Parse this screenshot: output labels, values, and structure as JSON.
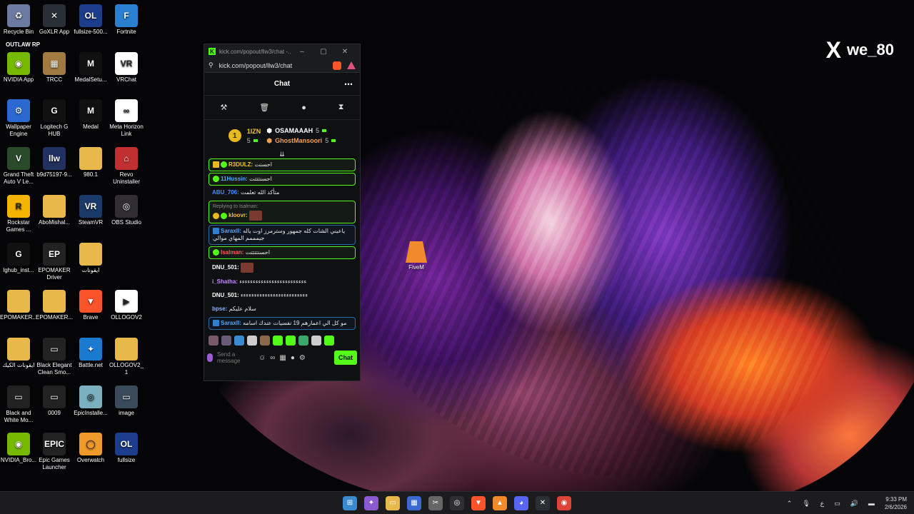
{
  "watermark": {
    "icon": "x-logo-icon",
    "symbol": "X",
    "handle": "we_80"
  },
  "desktop": {
    "icons": [
      {
        "label": "Recycle Bin",
        "name": "recycle-bin-icon",
        "color": "#6a7aa0",
        "glyph": "♻"
      },
      {
        "label": "GoXLR App",
        "name": "goxlr-icon",
        "color": "#2a2f36",
        "glyph": "✕"
      },
      {
        "label": "fullsize-500...",
        "name": "fullsize-icon",
        "color": "#1c3c8c",
        "glyph": "OL"
      },
      {
        "label": "Fortnite",
        "name": "fortnite-icon",
        "color": "#2b7fd0",
        "glyph": "F"
      },
      {
        "label": "NVIDIA App",
        "name": "nvidia-icon",
        "color": "#76b900",
        "glyph": "◉"
      },
      {
        "label": "TRCC",
        "name": "trcc-icon",
        "color": "#a07a40",
        "glyph": "▦"
      },
      {
        "label": "MedalSetu...",
        "name": "medal-setup-icon",
        "color": "#111111",
        "glyph": "M"
      },
      {
        "label": "VRChat",
        "name": "vrchat-icon",
        "color": "#ffffff",
        "glyph": "VR"
      },
      {
        "label": "Wallpaper Engine",
        "name": "wallpaper-engine-icon",
        "color": "#2a6ad0",
        "glyph": "⚙"
      },
      {
        "label": "Logitech G HUB",
        "name": "logitech-icon",
        "color": "#111111",
        "glyph": "G"
      },
      {
        "label": "Medal",
        "name": "medal-icon",
        "color": "#111111",
        "glyph": "M"
      },
      {
        "label": "Meta Horizon Link",
        "name": "meta-icon",
        "color": "#ffffff",
        "glyph": "∞"
      },
      {
        "label": "Grand Theft Auto V Le...",
        "name": "gta-icon",
        "color": "#2a4a2a",
        "glyph": "V"
      },
      {
        "label": "b9d75197-9...",
        "name": "image-file-icon",
        "color": "#203060",
        "glyph": "llw"
      },
      {
        "label": "980.1",
        "name": "folder-icon",
        "color": "#e8b84a",
        "glyph": ""
      },
      {
        "label": "Revo Uninstaller",
        "name": "revo-icon",
        "color": "#c03030",
        "glyph": "⌂"
      },
      {
        "label": "Rockstar Games ...",
        "name": "rockstar-icon",
        "color": "#f4b400",
        "glyph": "R"
      },
      {
        "label": "AboMishal...",
        "name": "folder-icon",
        "color": "#e8b84a",
        "glyph": ""
      },
      {
        "label": "SteamVR",
        "name": "steamvr-icon",
        "color": "#1a3a6a",
        "glyph": "VR"
      },
      {
        "label": "OBS Studio",
        "name": "obs-icon",
        "color": "#302e31",
        "glyph": "◎"
      },
      {
        "label": "lghub_inst...",
        "name": "lghub-icon",
        "color": "#111111",
        "glyph": "G"
      },
      {
        "label": "EPOMAKER Driver",
        "name": "epomaker-icon",
        "color": "#222222",
        "glyph": "EP"
      },
      {
        "label": "ايقونات",
        "name": "folder-icon",
        "color": "#e8b84a",
        "glyph": ""
      },
      {
        "label": "",
        "name": "blank-slot",
        "color": "transparent",
        "glyph": ""
      },
      {
        "label": "EPOMAKER...",
        "name": "folder-icon",
        "color": "#e8b84a",
        "glyph": ""
      },
      {
        "label": "EPOMAKER...",
        "name": "folder-icon",
        "color": "#e8b84a",
        "glyph": ""
      },
      {
        "label": "Brave",
        "name": "brave-icon",
        "color": "#fb542b",
        "glyph": "▼"
      },
      {
        "label": "OLLOGOV2",
        "name": "video-file-icon",
        "color": "#ffffff",
        "glyph": "▶"
      },
      {
        "label": "ايقونات الكيك",
        "name": "folder-icon",
        "color": "#e8b84a",
        "glyph": ""
      },
      {
        "label": "Black Elegant Clean Smo...",
        "name": "video-file-icon",
        "color": "#222222",
        "glyph": "▭"
      },
      {
        "label": "Battle.net",
        "name": "battlenet-icon",
        "color": "#1a7ad0",
        "glyph": "✦"
      },
      {
        "label": "OLLOGOV2_1",
        "name": "folder-icon",
        "color": "#e8b84a",
        "glyph": ""
      },
      {
        "label": "Black and White Mo...",
        "name": "video-file-icon",
        "color": "#222222",
        "glyph": "▭"
      },
      {
        "label": "0009",
        "name": "video-file-icon",
        "color": "#222222",
        "glyph": "▭"
      },
      {
        "label": "EpicInstalle...",
        "name": "installer-icon",
        "color": "#7ab0c0",
        "glyph": "◎"
      },
      {
        "label": "image",
        "name": "image-file-icon",
        "color": "#3a4a5a",
        "glyph": "▭"
      },
      {
        "label": "NVIDIA_Bro...",
        "name": "nvidia-icon",
        "color": "#76b900",
        "glyph": "◉"
      },
      {
        "label": "Epic Games Launcher",
        "name": "epic-icon",
        "color": "#222222",
        "glyph": "EPIC"
      },
      {
        "label": "Overwatch",
        "name": "overwatch-icon",
        "color": "#f09a2a",
        "glyph": "◯"
      },
      {
        "label": "fullsize",
        "name": "fullsize-icon",
        "color": "#1c3c8c",
        "glyph": "OL"
      }
    ],
    "overlay_text": "OUTLAW RP",
    "fivem": {
      "label": "FiveM"
    }
  },
  "chat_window": {
    "title": "kick.com/popout/llw3/chat -...",
    "url": "kick.com/popout/llw3/chat",
    "header": "Chat",
    "mod_tools": [
      "hammer-icon",
      "trash-icon",
      "chat-bubble-icon",
      "hourglass-icon"
    ],
    "leaderboard": {
      "rank": "1",
      "left_user": "1IZN",
      "left_count": "5",
      "right": [
        {
          "user": "OSAMAAAH",
          "count": "5"
        },
        {
          "user": "GhostMansoori",
          "count": "5"
        }
      ]
    },
    "messages": [
      {
        "user": "R3DULZ:",
        "text": "احسنت",
        "color": "#f4c430",
        "style": "hl",
        "badges": [
          "crown",
          "verified"
        ]
      },
      {
        "user": "11Hussin:",
        "text": "احسنتتتت",
        "color": "#53a8ff",
        "style": "hl",
        "badges": [
          "verified"
        ]
      },
      {
        "user": "ABU_706:",
        "text": "متأكد الله تعلمت",
        "color": "#4a8cff",
        "style": "",
        "badges": []
      },
      {
        "reply": "Replying to Isalman:",
        "user": "kloovr:",
        "text": "",
        "color": "#f4c430",
        "style": "hl",
        "badges": [
          "gold",
          "verified"
        ],
        "emote": true
      },
      {
        "user": "Saraxll:",
        "text": "ياعيني الشات كله جمهور وسترمرز اوت ياله جيمممم المهاي موالي",
        "color": "#53a8ff",
        "style": "hl-blue",
        "badges": [
          "blue"
        ]
      },
      {
        "user": "Isalman:",
        "text": "احسنتتتتت",
        "color": "#ff5a5a",
        "style": "hl",
        "badges": [
          "verified"
        ]
      },
      {
        "user": "DNU_501:",
        "text": "",
        "color": "#ffffff",
        "style": "",
        "badges": [],
        "emote": true
      },
      {
        "user": "i_Shatha:",
        "text": "ءءءءءءءءءءءءءءءءءءءءءءءءء",
        "color": "#c78aff",
        "style": "",
        "badges": []
      },
      {
        "user": "DNU_501:",
        "text": "ءءءءءءءءءءءءءءءءءءءءءءءءء",
        "color": "#ffffff",
        "style": "",
        "badges": []
      },
      {
        "user": "bpse:",
        "text": "سلام عليكم",
        "color": "#8ab4ff",
        "style": "",
        "badges": []
      },
      {
        "user": "Saraxll:",
        "text": "مو كل الي اعمارهم 19 نفسيات عندك اسامه",
        "color": "#53a8ff",
        "style": "hl-blue",
        "badges": [
          "blue"
        ]
      }
    ],
    "emote_colors": [
      "#7a5a6a",
      "#6a5a7a",
      "#3a8ad0",
      "#cccccc",
      "#8a6a4a",
      "#53fc18",
      "#53fc18",
      "#3aa86a",
      "#cccccc",
      "#53fc18"
    ],
    "input_placeholder": "Send a message",
    "send_label": "Chat"
  },
  "taskbar": {
    "apps": [
      {
        "name": "start-icon",
        "color": "#3a8ad0",
        "glyph": "⊞"
      },
      {
        "name": "copilot-icon",
        "color": "#8a5ad0",
        "glyph": "✦"
      },
      {
        "name": "file-explorer-icon",
        "color": "#e8b84a",
        "glyph": "▭"
      },
      {
        "name": "store-icon",
        "color": "#3a6ad0",
        "glyph": "▦"
      },
      {
        "name": "snipping-icon",
        "color": "#666666",
        "glyph": "✂"
      },
      {
        "name": "obs-icon",
        "color": "#302e31",
        "glyph": "◎"
      },
      {
        "name": "brave-icon",
        "color": "#fb542b",
        "glyph": "▼"
      },
      {
        "name": "fivem-icon",
        "color": "#f08a2a",
        "glyph": "▲"
      },
      {
        "name": "discord-icon",
        "color": "#5865f2",
        "glyph": "◕"
      },
      {
        "name": "goxlr-icon",
        "color": "#2a2f36",
        "glyph": "✕"
      },
      {
        "name": "chrome-icon",
        "color": "#db4437",
        "glyph": "◉"
      }
    ],
    "tray": {
      "lang": "ع",
      "time": "9:33 PM",
      "date": "2/6/2026"
    }
  }
}
